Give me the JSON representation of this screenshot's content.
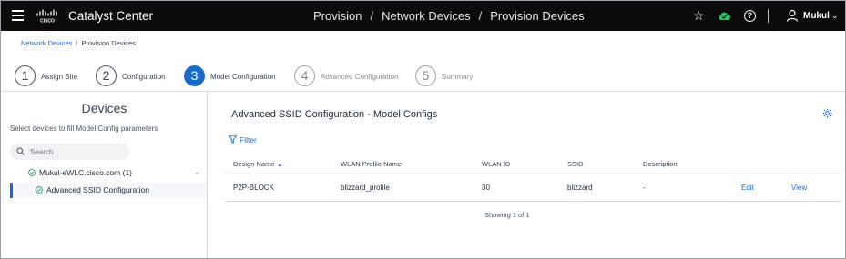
{
  "header": {
    "app_title": "Catalyst Center",
    "breadcrumb": [
      "Provision",
      "Network Devices",
      "Provision Devices"
    ],
    "separator": "/",
    "user_name": "Mukul",
    "icons": [
      "hamburger-menu-icon",
      "cisco-logo",
      "star-icon",
      "cloud-status-icon",
      "help-icon",
      "user-icon",
      "chevron-down-icon"
    ],
    "status_color": "#22c55e"
  },
  "breadcrumb": {
    "parent": "Network Devices",
    "separator": "/",
    "current": "Provision Devices"
  },
  "steps": [
    {
      "number": "1",
      "label": "Assign Site",
      "state": "done"
    },
    {
      "number": "2",
      "label": "Configuration",
      "state": "done"
    },
    {
      "number": "3",
      "label": "Model Configuration",
      "state": "active"
    },
    {
      "number": "4",
      "label": "Advanced Configuration",
      "state": "future"
    },
    {
      "number": "5",
      "label": "Summary",
      "state": "future"
    }
  ],
  "left_panel": {
    "title": "Devices",
    "subtitle": "Select devices to fill Model Config parameters",
    "search_placeholder": "Search",
    "tree": {
      "device": "Mukul-eWLC.cisco.com (1)",
      "child": "Advanced SSID Configuration"
    }
  },
  "main": {
    "title": "Advanced SSID Configuration - Model Configs",
    "filter_label": "Filter",
    "table": {
      "columns": [
        "Design Name",
        "WLAN Profile Name",
        "WLAN ID",
        "SSID",
        "Description"
      ],
      "rows": [
        {
          "design_name": "P2P-BLOCK",
          "wlan_profile": "blizzard_profile",
          "wlan_id": "30",
          "ssid": "blizzard",
          "description": "-",
          "edit": "Edit",
          "view": "View"
        }
      ]
    },
    "footer": "Showing 1 of 1"
  },
  "colors": {
    "accent": "#1b6ac9",
    "header_bg": "#0b0b0b",
    "success": "#22a06b"
  }
}
